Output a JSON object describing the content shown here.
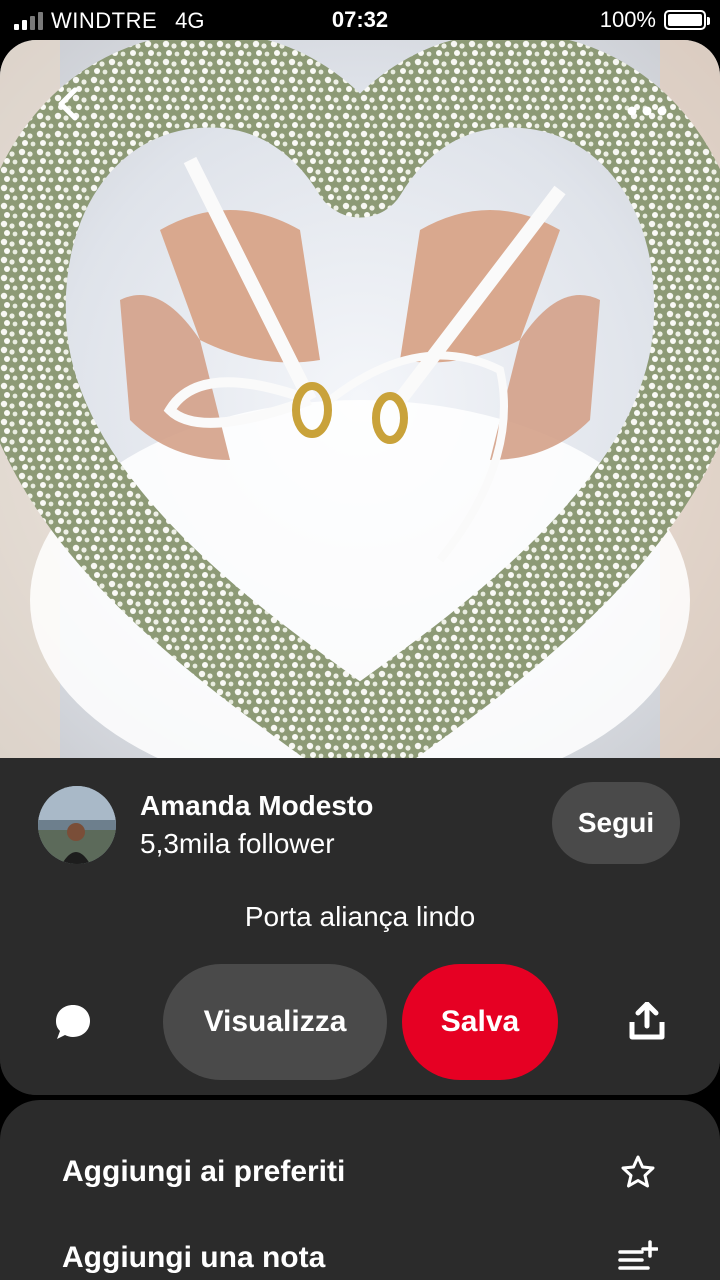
{
  "status_bar": {
    "carrier": "WINDTRE",
    "network": "4G",
    "time": "07:32",
    "battery": "100%"
  },
  "pin": {
    "creator_name": "Amanda Modesto",
    "creator_followers": "5,3mila follower",
    "follow_label": "Segui",
    "title": "Porta aliança lindo",
    "view_label": "Visualizza",
    "save_label": "Salva"
  },
  "sheet": {
    "items": [
      {
        "label": "Aggiungi ai preferiti",
        "icon": "star-icon"
      },
      {
        "label": "Aggiungi una nota",
        "icon": "note-add-icon"
      }
    ]
  },
  "colors": {
    "save_button": "#e60023",
    "panel": "#2b2b2b",
    "pill": "#4a4a4a"
  }
}
